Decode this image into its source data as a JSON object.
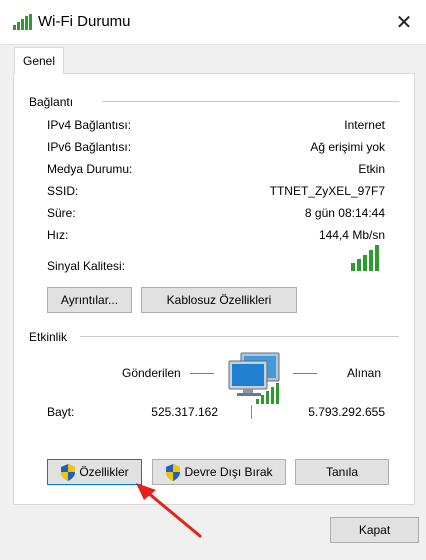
{
  "window": {
    "title": "Wi-Fi Durumu",
    "close_glyph": "✕"
  },
  "tabs": [
    {
      "label": "Genel"
    }
  ],
  "connection": {
    "heading": "Bağlantı",
    "rows": [
      {
        "label": "IPv4 Bağlantısı:",
        "value": "Internet"
      },
      {
        "label": "IPv6 Bağlantısı:",
        "value": "Ağ erişimi yok"
      },
      {
        "label": "Medya Durumu:",
        "value": "Etkin"
      },
      {
        "label": "SSID:",
        "value": "TTNET_ZyXEL_97F7"
      },
      {
        "label": "Süre:",
        "value": "8 gün 08:14:44"
      },
      {
        "label": "Hız:",
        "value": "144,4 Mb/sn"
      }
    ],
    "signal_label": "Sinyal Kalitesi:",
    "signal_bars_lit": 5,
    "signal_bars_total": 5,
    "details_button": "Ayrıntılar...",
    "wireless_props_button": "Kablosuz Özellikleri"
  },
  "activity": {
    "heading": "Etkinlik",
    "sent_label": "Gönderilen",
    "received_label": "Alınan",
    "bytes_label": "Bayt:",
    "bytes_sent": "525.317.162",
    "bytes_received": "5.793.292.655"
  },
  "actions": {
    "properties": "Özellikler",
    "disable": "Devre Dışı Bırak",
    "diagnose": "Tanıla"
  },
  "footer": {
    "close_button": "Kapat"
  },
  "colors": {
    "accent": "#0078d7",
    "signal_green": "#2e9b2e",
    "arrow_red": "#e8201a"
  },
  "icons": {
    "window": "wifi-signal-icon",
    "network": "network-computer-icon",
    "shield": "uac-shield-icon"
  }
}
